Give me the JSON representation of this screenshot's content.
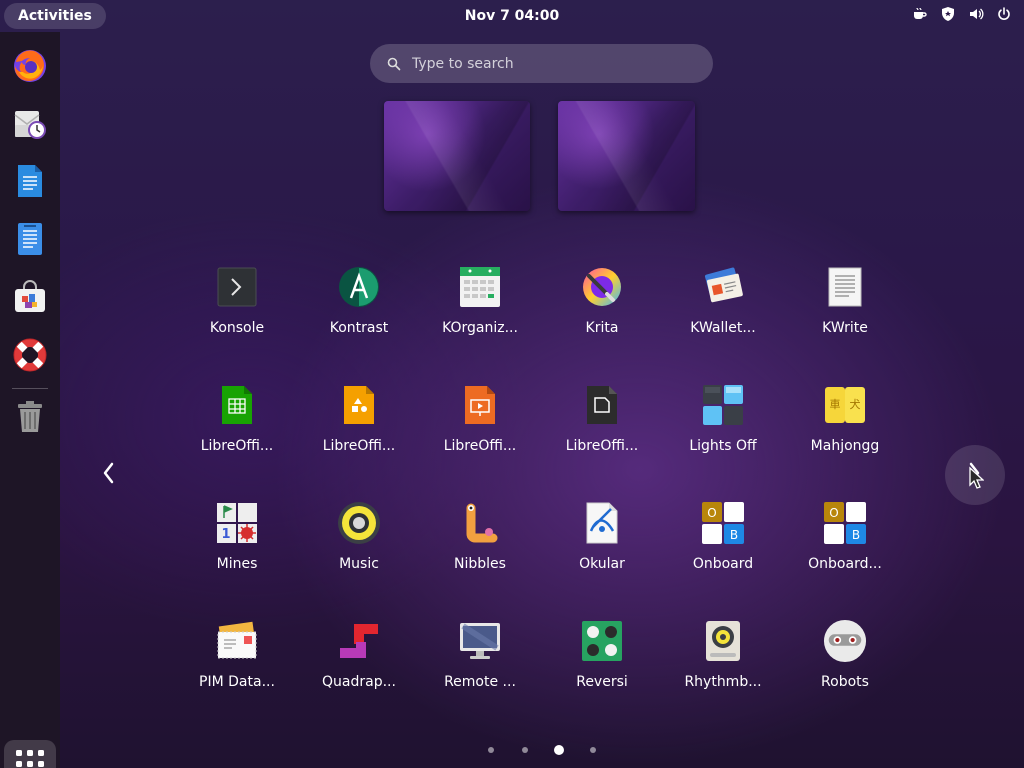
{
  "topbar": {
    "activities_label": "Activities",
    "clock": "Nov 7  04:00",
    "status_icons": [
      "coffee-icon",
      "shield-icon",
      "volume-icon",
      "power-icon"
    ]
  },
  "dash": {
    "items": [
      {
        "name": "firefox",
        "icon": "firefox-icon"
      },
      {
        "name": "mail-scheduler",
        "icon": "mail-clock-icon"
      },
      {
        "name": "libreoffice-writer",
        "icon": "document-icon"
      },
      {
        "name": "document-viewer",
        "icon": "document-viewer-icon"
      },
      {
        "name": "software-store",
        "icon": "shopping-bag-icon"
      },
      {
        "name": "help",
        "icon": "lifebuoy-icon"
      },
      {
        "name": "trash",
        "icon": "trash-icon"
      }
    ],
    "show_apps_icon": "grid-icon"
  },
  "search": {
    "placeholder": "Type to search",
    "value": ""
  },
  "workspaces": [
    "workspace-1",
    "workspace-2"
  ],
  "apps": [
    {
      "label": "Konsole",
      "icon": "terminal-icon"
    },
    {
      "label": "Kontrast",
      "icon": "kontrast-icon"
    },
    {
      "label": "KOrganiz...",
      "icon": "calendar-icon"
    },
    {
      "label": "Krita",
      "icon": "krita-icon"
    },
    {
      "label": "KWallet...",
      "icon": "wallet-icon"
    },
    {
      "label": "KWrite",
      "icon": "text-editor-icon"
    },
    {
      "label": "LibreOffi...",
      "icon": "spreadsheet-icon"
    },
    {
      "label": "LibreOffi...",
      "icon": "draw-icon"
    },
    {
      "label": "LibreOffi...",
      "icon": "presentation-icon"
    },
    {
      "label": "LibreOffi...",
      "icon": "libreoffice-icon"
    },
    {
      "label": "Lights Off",
      "icon": "lights-off-icon"
    },
    {
      "label": "Mahjongg",
      "icon": "mahjongg-icon"
    },
    {
      "label": "Mines",
      "icon": "mines-icon"
    },
    {
      "label": "Music",
      "icon": "speaker-icon"
    },
    {
      "label": "Nibbles",
      "icon": "worm-icon"
    },
    {
      "label": "Okular",
      "icon": "okular-icon"
    },
    {
      "label": "Onboard",
      "icon": "keyboard-icon"
    },
    {
      "label": "Onboard...",
      "icon": "keyboard-settings-icon"
    },
    {
      "label": "PIM Data...",
      "icon": "mail-stack-icon"
    },
    {
      "label": "Quadrap...",
      "icon": "tetromino-icon"
    },
    {
      "label": "Remote ...",
      "icon": "remote-desktop-icon"
    },
    {
      "label": "Reversi",
      "icon": "reversi-icon"
    },
    {
      "label": "Rhythmb...",
      "icon": "rhythmbox-icon"
    },
    {
      "label": "Robots",
      "icon": "robot-icon"
    }
  ],
  "pagination": {
    "pages": 4,
    "current": 3
  },
  "colors": {
    "dash_bg": "#1e1526",
    "libreoffice_calc": "#18a303",
    "libreoffice_draw": "#f5a000",
    "libreoffice_impress": "#ed6b22",
    "reversi_green": "#27a361"
  }
}
